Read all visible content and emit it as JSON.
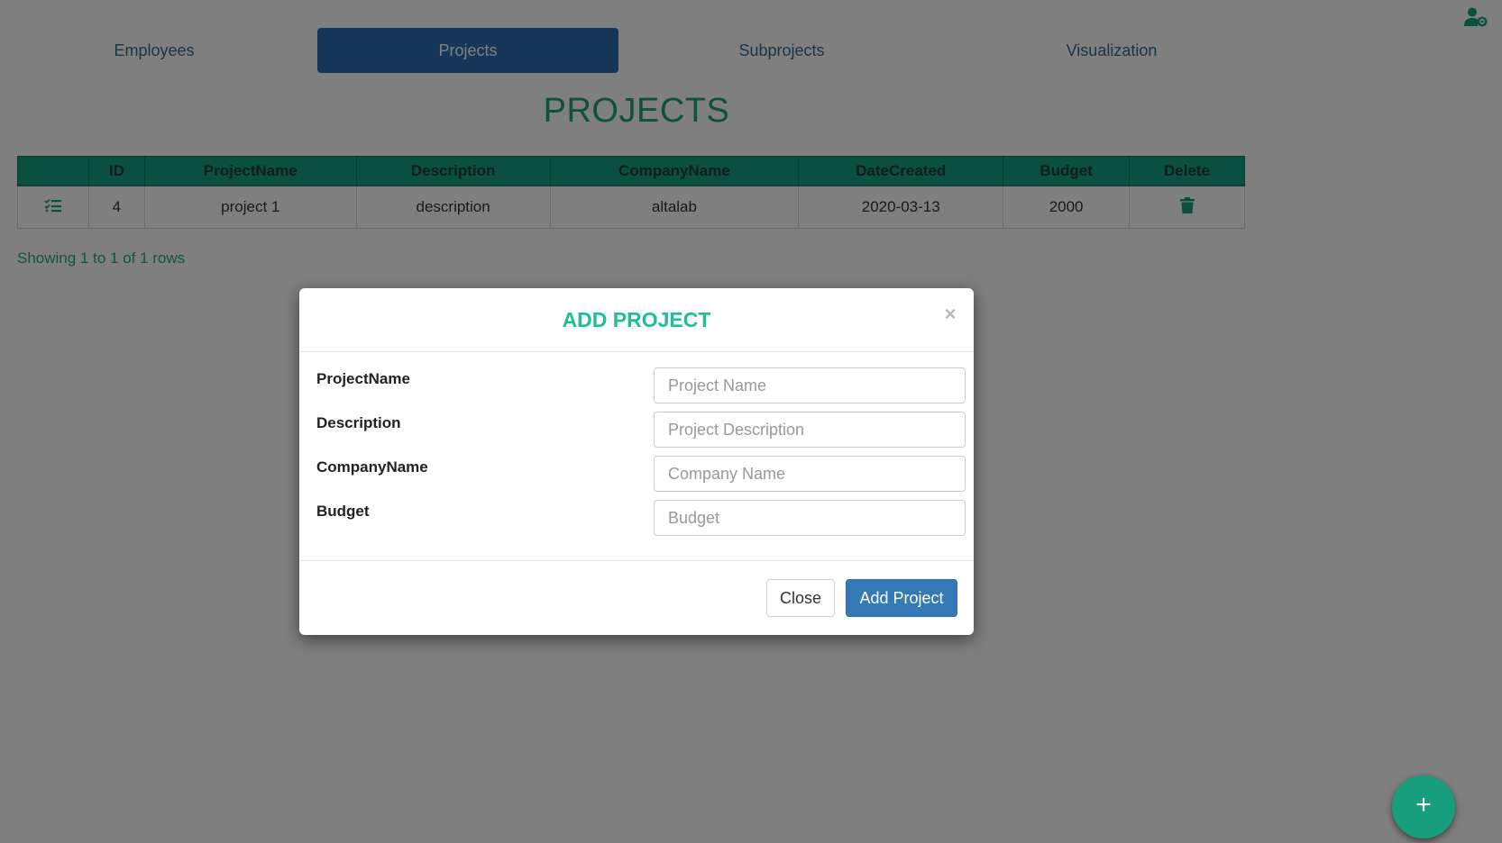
{
  "nav": {
    "tabs": [
      {
        "label": "Employees"
      },
      {
        "label": "Projects"
      },
      {
        "label": "Subprojects"
      },
      {
        "label": "Visualization"
      }
    ],
    "active": "Projects"
  },
  "page": {
    "title": "PROJECTS"
  },
  "table": {
    "columns": [
      "",
      "ID",
      "ProjectName",
      "Description",
      "CompanyName",
      "DateCreated",
      "Budget",
      "Delete"
    ],
    "rows": [
      {
        "id": "4",
        "project_name": "project 1",
        "description": "description",
        "company_name": "altalab",
        "date_created": "2020-03-13",
        "budget": "2000"
      }
    ],
    "info": "Showing 1 to 1 of 1 rows"
  },
  "modal": {
    "title": "ADD PROJECT",
    "close_symbol": "×",
    "fields": [
      {
        "label": "ProjectName",
        "placeholder": "Project Name",
        "value": ""
      },
      {
        "label": "Description",
        "placeholder": "Project Description",
        "value": ""
      },
      {
        "label": "CompanyName",
        "placeholder": "Company Name",
        "value": ""
      },
      {
        "label": "Budget",
        "placeholder": "Budget",
        "value": ""
      }
    ],
    "close_label": "Close",
    "submit_label": "Add Project"
  },
  "fab": {
    "symbol": "+"
  },
  "colors": {
    "accent": "#169e7d",
    "nav_active": "#2f6fb1",
    "primary_button": "#337ab7",
    "modal_title": "#1fbf93"
  },
  "icons": {
    "user": "user-gear-icon",
    "details": "list-check-icon",
    "delete": "trash-icon",
    "close": "close-icon",
    "fab": "plus-icon"
  }
}
